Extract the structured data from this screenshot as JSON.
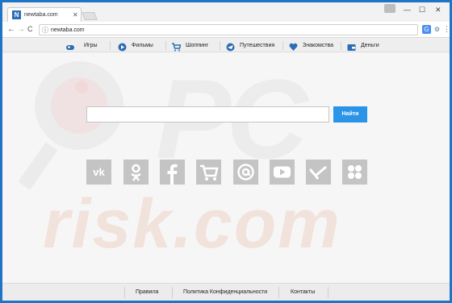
{
  "browser": {
    "tab_title": "newtaba.com",
    "tab_favicon_letter": "N",
    "tab_close": "✕",
    "window_minimize": "—",
    "window_maximize": "☐",
    "window_close": "✕",
    "url": "newtaba.com",
    "nav_back": "←",
    "nav_forward": "→",
    "nav_reload": "C",
    "menu": "⋮"
  },
  "categories": [
    {
      "label": "Игры",
      "icon": "gamepad-icon",
      "color": "#2d6db5"
    },
    {
      "label": "Фильмы",
      "icon": "play-icon",
      "color": "#2d6db5"
    },
    {
      "label": "Шоппинг",
      "icon": "cart-icon",
      "color": "#2d6db5"
    },
    {
      "label": "Путешествия",
      "icon": "plane-icon",
      "color": "#2d6db5"
    },
    {
      "label": "Знакомства",
      "icon": "heart-icon",
      "color": "#2d6db5"
    },
    {
      "label": "Деньги",
      "icon": "wallet-icon",
      "color": "#2d6db5"
    }
  ],
  "search": {
    "placeholder": "",
    "button_label": "Найти",
    "button_color": "#2a95e8"
  },
  "tiles": [
    {
      "name": "vk-icon"
    },
    {
      "name": "odnoklassniki-icon"
    },
    {
      "name": "facebook-icon"
    },
    {
      "name": "shopping-cart-icon"
    },
    {
      "name": "mail-ru-icon"
    },
    {
      "name": "youtube-icon"
    },
    {
      "name": "vimeo-icon"
    },
    {
      "name": "dots-icon"
    }
  ],
  "watermark": {
    "top": "PC",
    "bottom": "risk.com"
  },
  "footer": {
    "links": [
      "Правила",
      "Политика Конфиденциальности",
      "Контакты"
    ]
  }
}
